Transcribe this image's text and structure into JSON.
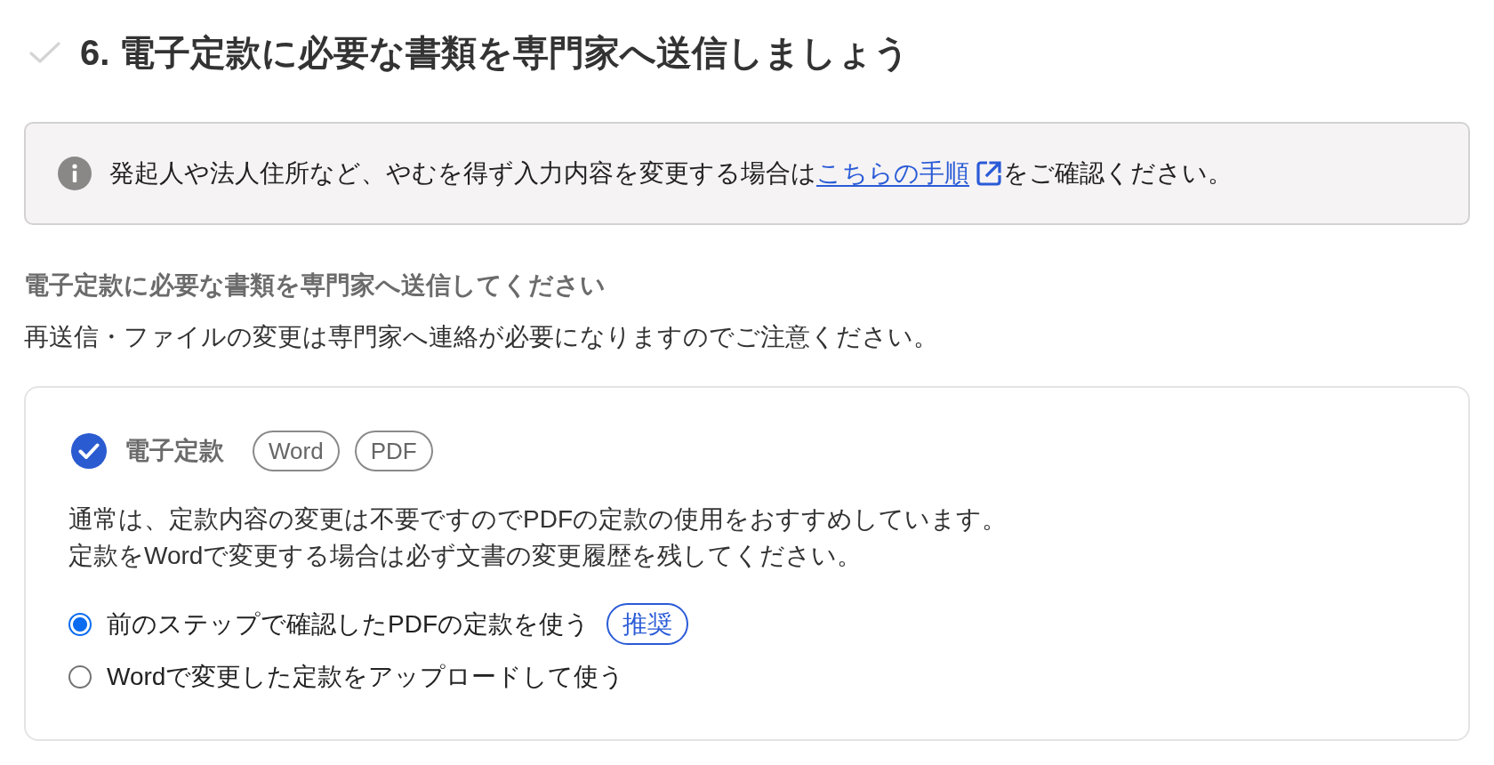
{
  "header": {
    "completed": false,
    "title": "6. 電子定款に必要な書類を専門家へ送信しましょう"
  },
  "notice": {
    "text_before": "発起人や法人住所など、やむを得ず入力内容を変更する場合は",
    "link": "こちらの手順",
    "text_after": "をご確認ください。"
  },
  "section": {
    "title": "電子定款に必要な書類を専門家へ送信してください",
    "description": "再送信・ファイルの変更は専門家へ連絡が必要になりますのでご注意ください。"
  },
  "card": {
    "checked": true,
    "title": "電子定款",
    "formats": [
      "Word",
      "PDF"
    ],
    "description_lines": [
      "通常は、定款内容の変更は不要ですのでPDFの定款の使用をおすすめしています。",
      "定款をWordで変更する場合は必ず文書の変更履歴を残してください。"
    ],
    "options": [
      {
        "label": "前のステップで確認したPDFの定款を使う",
        "selected": true,
        "badge": "推奨"
      },
      {
        "label": "Wordで変更した定款をアップロードして使う",
        "selected": false
      }
    ]
  }
}
